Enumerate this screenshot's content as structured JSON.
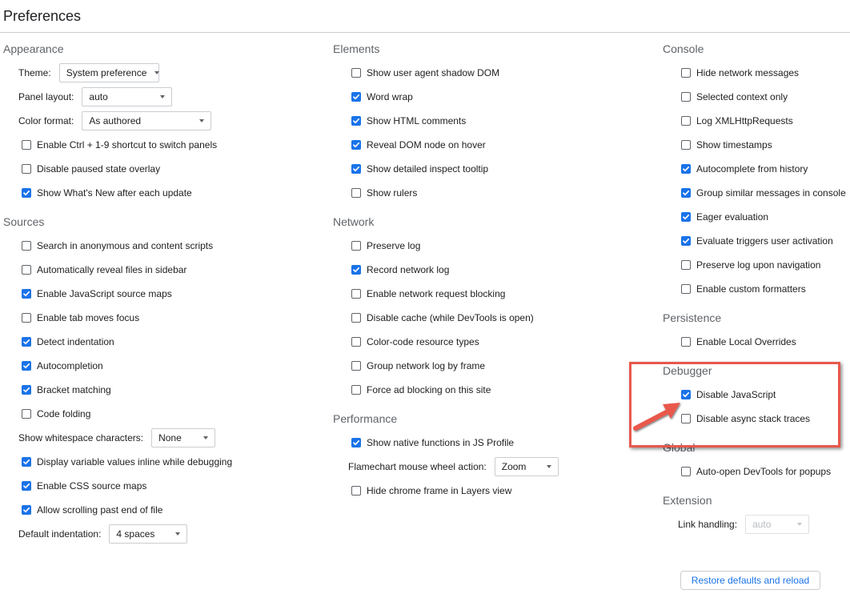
{
  "title": "Preferences",
  "columns": [
    {
      "sections": [
        {
          "title": "Appearance",
          "rows": [
            {
              "type": "select",
              "label": "Theme:",
              "value": "System preference"
            },
            {
              "type": "select",
              "label": "Panel layout:",
              "value": "auto"
            },
            {
              "type": "select",
              "label": "Color format:",
              "value": "As authored"
            },
            {
              "type": "checkbox",
              "label": "Enable Ctrl + 1-9 shortcut to switch panels",
              "checked": false
            },
            {
              "type": "checkbox",
              "label": "Disable paused state overlay",
              "checked": false
            },
            {
              "type": "checkbox",
              "label": "Show What's New after each update",
              "checked": true
            }
          ]
        },
        {
          "title": "Sources",
          "rows": [
            {
              "type": "checkbox",
              "label": "Search in anonymous and content scripts",
              "checked": false
            },
            {
              "type": "checkbox",
              "label": "Automatically reveal files in sidebar",
              "checked": false
            },
            {
              "type": "checkbox",
              "label": "Enable JavaScript source maps",
              "checked": true
            },
            {
              "type": "checkbox",
              "label": "Enable tab moves focus",
              "checked": false
            },
            {
              "type": "checkbox",
              "label": "Detect indentation",
              "checked": true
            },
            {
              "type": "checkbox",
              "label": "Autocompletion",
              "checked": true
            },
            {
              "type": "checkbox",
              "label": "Bracket matching",
              "checked": true
            },
            {
              "type": "checkbox",
              "label": "Code folding",
              "checked": false
            },
            {
              "type": "select",
              "label": "Show whitespace characters:",
              "value": "None"
            },
            {
              "type": "checkbox",
              "label": "Display variable values inline while debugging",
              "checked": true
            },
            {
              "type": "checkbox",
              "label": "Enable CSS source maps",
              "checked": true
            },
            {
              "type": "checkbox",
              "label": "Allow scrolling past end of file",
              "checked": true
            },
            {
              "type": "select",
              "label": "Default indentation:",
              "value": "4 spaces"
            }
          ]
        }
      ]
    },
    {
      "sections": [
        {
          "title": "Elements",
          "rows": [
            {
              "type": "checkbox",
              "label": "Show user agent shadow DOM",
              "checked": false
            },
            {
              "type": "checkbox",
              "label": "Word wrap",
              "checked": true
            },
            {
              "type": "checkbox",
              "label": "Show HTML comments",
              "checked": true
            },
            {
              "type": "checkbox",
              "label": "Reveal DOM node on hover",
              "checked": true
            },
            {
              "type": "checkbox",
              "label": "Show detailed inspect tooltip",
              "checked": true
            },
            {
              "type": "checkbox",
              "label": "Show rulers",
              "checked": false
            }
          ]
        },
        {
          "title": "Network",
          "rows": [
            {
              "type": "checkbox",
              "label": "Preserve log",
              "checked": false
            },
            {
              "type": "checkbox",
              "label": "Record network log",
              "checked": true
            },
            {
              "type": "checkbox",
              "label": "Enable network request blocking",
              "checked": false
            },
            {
              "type": "checkbox",
              "label": "Disable cache (while DevTools is open)",
              "checked": false
            },
            {
              "type": "checkbox",
              "label": "Color-code resource types",
              "checked": false
            },
            {
              "type": "checkbox",
              "label": "Group network log by frame",
              "checked": false
            },
            {
              "type": "checkbox",
              "label": "Force ad blocking on this site",
              "checked": false
            }
          ]
        },
        {
          "title": "Performance",
          "rows": [
            {
              "type": "checkbox",
              "label": "Show native functions in JS Profile",
              "checked": true
            },
            {
              "type": "select",
              "label": "Flamechart mouse wheel action:",
              "value": "Zoom"
            },
            {
              "type": "checkbox",
              "label": "Hide chrome frame in Layers view",
              "checked": false
            }
          ]
        }
      ]
    },
    {
      "sections": [
        {
          "title": "Console",
          "rows": [
            {
              "type": "checkbox",
              "label": "Hide network messages",
              "checked": false
            },
            {
              "type": "checkbox",
              "label": "Selected context only",
              "checked": false
            },
            {
              "type": "checkbox",
              "label": "Log XMLHttpRequests",
              "checked": false
            },
            {
              "type": "checkbox",
              "label": "Show timestamps",
              "checked": false
            },
            {
              "type": "checkbox",
              "label": "Autocomplete from history",
              "checked": true
            },
            {
              "type": "checkbox",
              "label": "Group similar messages in console",
              "checked": true
            },
            {
              "type": "checkbox",
              "label": "Eager evaluation",
              "checked": true
            },
            {
              "type": "checkbox",
              "label": "Evaluate triggers user activation",
              "checked": true
            },
            {
              "type": "checkbox",
              "label": "Preserve log upon navigation",
              "checked": false
            },
            {
              "type": "checkbox",
              "label": "Enable custom formatters",
              "checked": false
            }
          ]
        },
        {
          "title": "Persistence",
          "rows": [
            {
              "type": "checkbox",
              "label": "Enable Local Overrides",
              "checked": false
            }
          ]
        },
        {
          "title": "Debugger",
          "rows": [
            {
              "type": "checkbox",
              "label": "Disable JavaScript",
              "checked": true
            },
            {
              "type": "checkbox",
              "label": "Disable async stack traces",
              "checked": false
            }
          ]
        },
        {
          "title": "Global",
          "rows": [
            {
              "type": "checkbox",
              "label": "Auto-open DevTools for popups",
              "checked": false
            }
          ]
        },
        {
          "title": "Extension",
          "rows": [
            {
              "type": "select",
              "label": "Link handling:",
              "value": "auto",
              "disabled": true
            }
          ]
        }
      ]
    }
  ],
  "restore_button": "Restore defaults and reload",
  "annotation": {
    "color": "#e8584c",
    "target": "Disable JavaScript"
  },
  "colors": {
    "accent": "#1a73e8",
    "section_title": "#5f6368"
  }
}
